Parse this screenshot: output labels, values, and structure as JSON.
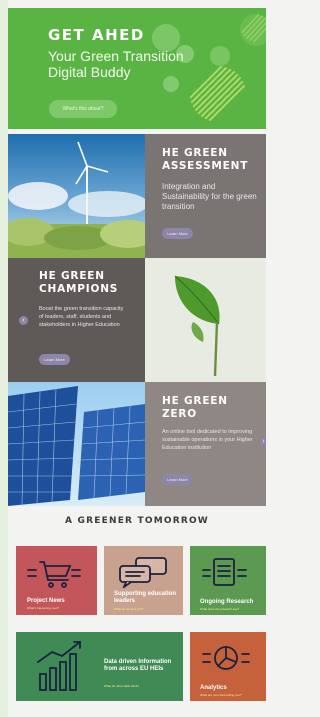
{
  "hero": {
    "logo": "GET AHED",
    "tagline": "Your Green Transition Digital Buddy",
    "cta_label": "What's this about?"
  },
  "assessment": {
    "title_line1": "HE GREEN",
    "title_line2": "ASSESSMENT",
    "body": "Integration and Sustainability for the green transition",
    "button": "Learn More",
    "next": "›"
  },
  "champions": {
    "title_line1": "HE GREEN",
    "title_line2": "CHAMPIONS",
    "body": "Boost the green transition capacity of leaders, staff, students and stakeholders in Higher Education",
    "button": "Learn More",
    "prev": "‹"
  },
  "zero": {
    "title_line1": "HE GREEN",
    "title_line2": "ZERO",
    "body": "An online tool dedicated to improving sustainable operations in your Higher Education institution",
    "button": "Learn More",
    "next": "›"
  },
  "greener": {
    "title": "A GREENER TOMORROW",
    "cards": [
      {
        "label": "Project News",
        "sub": "What's happening now?"
      },
      {
        "label": "Supporting education leaders",
        "sub": "What do we give you?"
      },
      {
        "label": "Ongoing Research",
        "sub": "What does the research say?"
      },
      {
        "label": "Data driven Information from across EU HEIs",
        "sub": "What do other HEIs think?"
      },
      {
        "label": "Analytics",
        "sub": "What are your data telling you?"
      }
    ]
  },
  "colors": {
    "hero_green": "#5ab443",
    "panel_grey": "#7a7473",
    "panel_grey_dark": "#5f5a58",
    "news_card": "#c2565a",
    "leaders_card": "#c9a18f",
    "research_card": "#5c9a52",
    "data_card": "#3f8a55",
    "analytics_card": "#c5623c"
  }
}
